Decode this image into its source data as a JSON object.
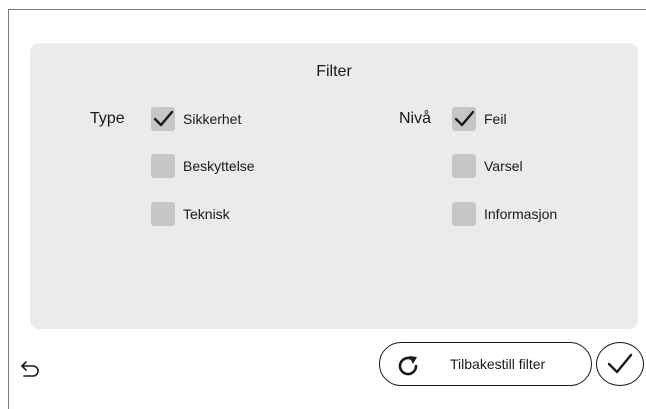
{
  "panel": {
    "title": "Filter"
  },
  "type_group": {
    "label": "Type",
    "options": [
      {
        "label": "Sikkerhet",
        "checked": true
      },
      {
        "label": "Beskyttelse",
        "checked": false
      },
      {
        "label": "Teknisk",
        "checked": false
      }
    ]
  },
  "level_group": {
    "label": "Nivå",
    "options": [
      {
        "label": "Feil",
        "checked": true
      },
      {
        "label": "Varsel",
        "checked": false
      },
      {
        "label": "Informasjon",
        "checked": false
      }
    ]
  },
  "footer": {
    "back_icon": "undo-arrow-icon",
    "reset_label": "Tilbakestill filter",
    "reset_icon": "refresh-icon",
    "confirm_icon": "checkmark-icon"
  },
  "colors": {
    "panel_bg": "#ebebeb",
    "checkbox_bg": "#c6c6c6",
    "text": "#1a1a1a"
  }
}
